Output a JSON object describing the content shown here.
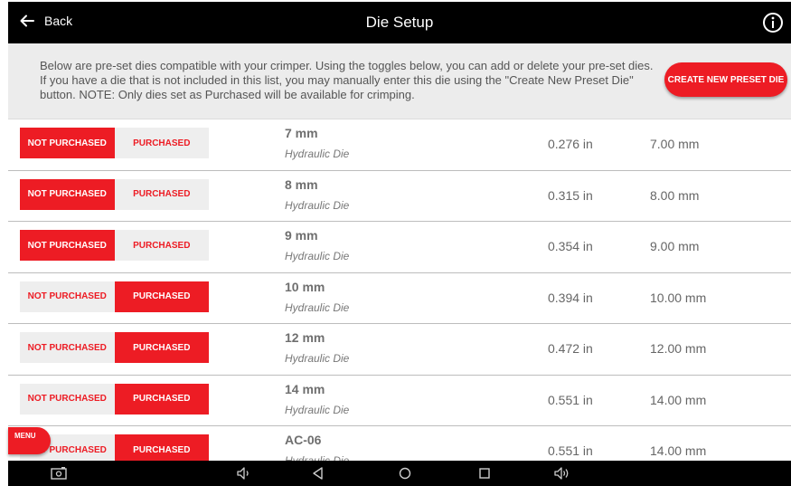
{
  "header": {
    "back_label": "Back",
    "title": "Die Setup"
  },
  "banner": {
    "text": "Below are pre-set dies compatible with your crimper. Using the toggles below, you can add or delete your pre-set dies. If you have a die that is not included in this list, you may manually enter this die using the \"Create New Preset Die\" button. NOTE: Only dies set as Purchased will be available for crimping.",
    "create_button": "CREATE NEW PRESET DIE"
  },
  "toggle_labels": {
    "not_purchased": "NOT PURCHASED",
    "purchased": "PURCHASED"
  },
  "dies": [
    {
      "name": "7 mm",
      "type": "Hydraulic Die",
      "inches": "0.276 in",
      "mm": "7.00 mm",
      "purchased": false
    },
    {
      "name": "8 mm",
      "type": "Hydraulic Die",
      "inches": "0.315 in",
      "mm": "8.00 mm",
      "purchased": false
    },
    {
      "name": "9 mm",
      "type": "Hydraulic Die",
      "inches": "0.354 in",
      "mm": "9.00 mm",
      "purchased": false
    },
    {
      "name": "10 mm",
      "type": "Hydraulic Die",
      "inches": "0.394 in",
      "mm": "10.00 mm",
      "purchased": true
    },
    {
      "name": "12 mm",
      "type": "Hydraulic Die",
      "inches": "0.472 in",
      "mm": "12.00 mm",
      "purchased": true
    },
    {
      "name": "14 mm",
      "type": "Hydraulic Die",
      "inches": "0.551 in",
      "mm": "14.00 mm",
      "purchased": true
    },
    {
      "name": "AC-06",
      "type": "Hydraulic Die",
      "inches": "0.551 in",
      "mm": "14.00 mm",
      "purchased": true
    }
  ],
  "menu_label": "MENU",
  "colors": {
    "accent": "#ed1c24",
    "toggle_off_bg": "#eeeeee",
    "banner_bg": "#ececec",
    "bar_bg": "#000000"
  },
  "nav_icons": [
    "screenshot-icon",
    "volume-down-icon",
    "back-triangle-icon",
    "home-circle-icon",
    "recents-square-icon",
    "volume-up-icon"
  ]
}
